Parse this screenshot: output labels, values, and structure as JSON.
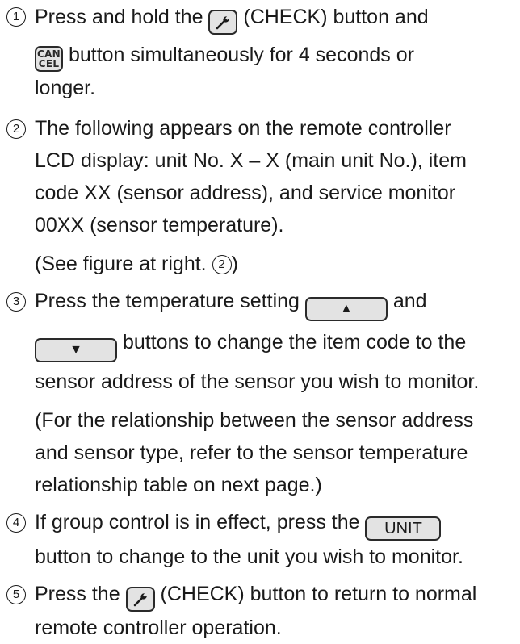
{
  "steps": [
    {
      "number": "1",
      "lines": {
        "l1_pre": "Press and hold the ",
        "l1_post": " (CHECK) button and",
        "l2_post": " button simultaneously for 4 seconds or",
        "l3": "longer."
      },
      "icons": {
        "check_key": "wrench-icon",
        "cancel_key_top": "CAN",
        "cancel_key_bottom": "CEL"
      }
    },
    {
      "number": "2",
      "lines": {
        "l1": "The following appears on the remote controller",
        "l2": "LCD display: unit No. X – X (main unit No.), item",
        "l3": "code XX (sensor address), and service monitor",
        "l4": "00XX (sensor temperature)."
      },
      "note_pre": "(See figure at right. ",
      "note_num": "2",
      "note_post": ")"
    },
    {
      "number": "3",
      "lines": {
        "l1_pre": "Press the temperature setting ",
        "l1_post": " and",
        "l2_post": " buttons to change the item code to the",
        "l3": "sensor address of the sensor you wish to monitor."
      },
      "up_key": "▲",
      "down_key": "▼",
      "note": {
        "l1": "(For the relationship between the sensor address",
        "l2": "and sensor type, refer to the sensor temperature",
        "l3": "relationship table on next page.)"
      }
    },
    {
      "number": "4",
      "lines": {
        "l1_pre": "If group control is in effect, press the ",
        "l2": "button to change to the unit you wish to monitor."
      },
      "unit_key": "UNIT"
    },
    {
      "number": "5",
      "lines": {
        "l1_pre": "Press the ",
        "l1_post": " (CHECK) button to return to normal",
        "l2": "remote controller operation."
      },
      "icons": {
        "check_key": "wrench-icon"
      }
    }
  ]
}
